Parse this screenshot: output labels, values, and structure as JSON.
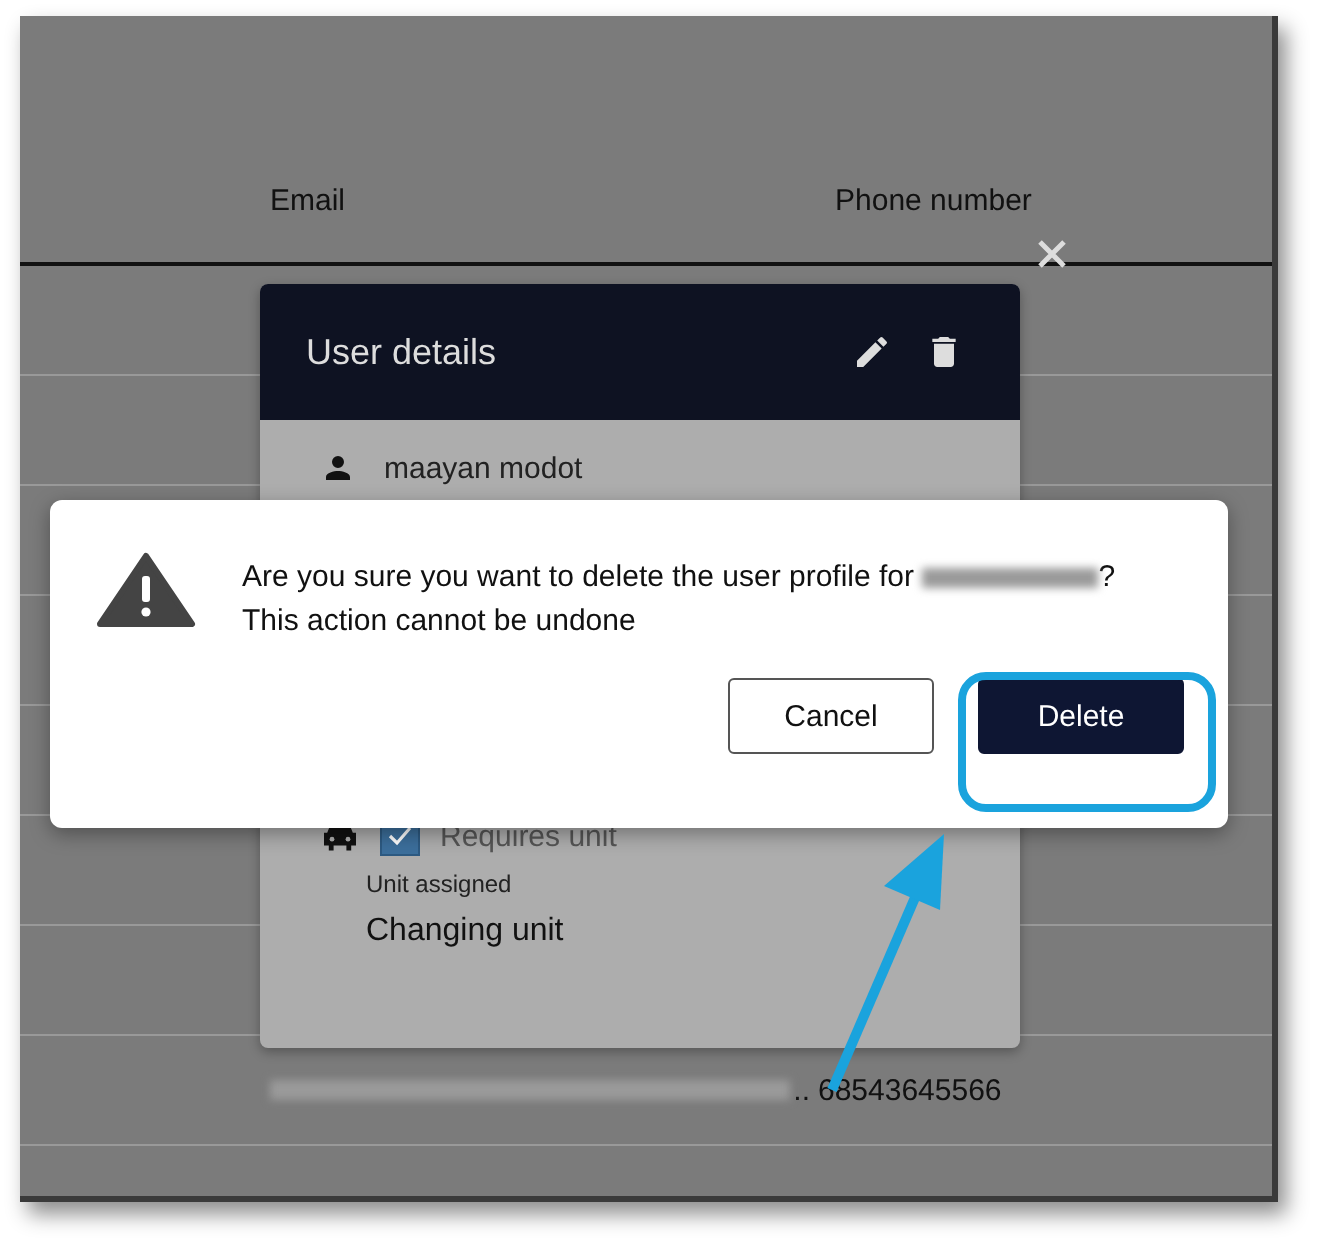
{
  "table": {
    "columns": [
      "Email",
      "Phone number"
    ],
    "rows": [
      {
        "email_redacted": true,
        "email": "..",
        "phone": "68543645566"
      }
    ]
  },
  "user_details": {
    "title": "User details",
    "name": "maayan modot",
    "requires_unit": {
      "label": "Requires unit",
      "checked": true
    },
    "unit_assigned": {
      "label": "Unit assigned",
      "value": "Changing unit"
    }
  },
  "alert": {
    "message_before": "Are you sure you want to delete the user profile for",
    "name_redacted": true,
    "message_after": "?",
    "line2": "This action cannot be undone",
    "buttons": [
      {
        "label": "Cancel",
        "kind": "secondary"
      },
      {
        "label": "Delete",
        "kind": "primary"
      }
    ]
  },
  "annotation": {
    "highlight": true,
    "arrow": true
  }
}
